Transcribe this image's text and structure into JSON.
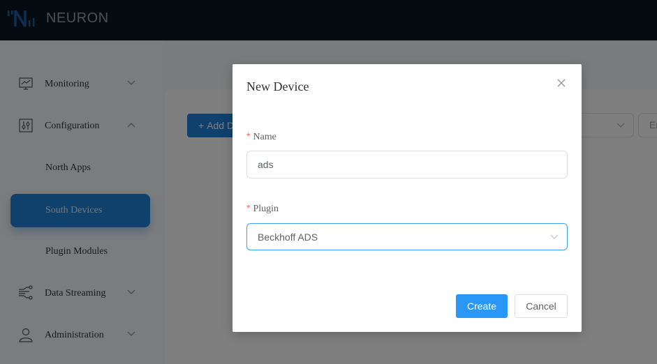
{
  "app": {
    "brand": "NEURON",
    "brand_color": "#1a5fa0",
    "accent_color": "#2997f5"
  },
  "sidebar": {
    "items": [
      {
        "label": "Monitoring",
        "icon": "monitor-chart-icon",
        "expanded": false
      },
      {
        "label": "Configuration",
        "icon": "sliders-icon",
        "expanded": true,
        "children": [
          {
            "label": "North Apps",
            "active": false
          },
          {
            "label": "South Devices",
            "active": true
          },
          {
            "label": "Plugin Modules",
            "active": false
          }
        ]
      },
      {
        "label": "Data Streaming",
        "icon": "circuit-icon",
        "expanded": false
      },
      {
        "label": "Administration",
        "icon": "user-icon",
        "expanded": false
      }
    ]
  },
  "background": {
    "add_button_label": "Add D",
    "filter_input_placeholder": "En"
  },
  "modal": {
    "title": "New Device",
    "close_icon": "close-icon",
    "fields": {
      "name": {
        "label": "Name",
        "required_mark": "*",
        "value": "ads"
      },
      "plugin": {
        "label": "Plugin",
        "required_mark": "*",
        "selected": "Beckhoff ADS"
      }
    },
    "buttons": {
      "create": "Create",
      "cancel": "Cancel"
    }
  }
}
